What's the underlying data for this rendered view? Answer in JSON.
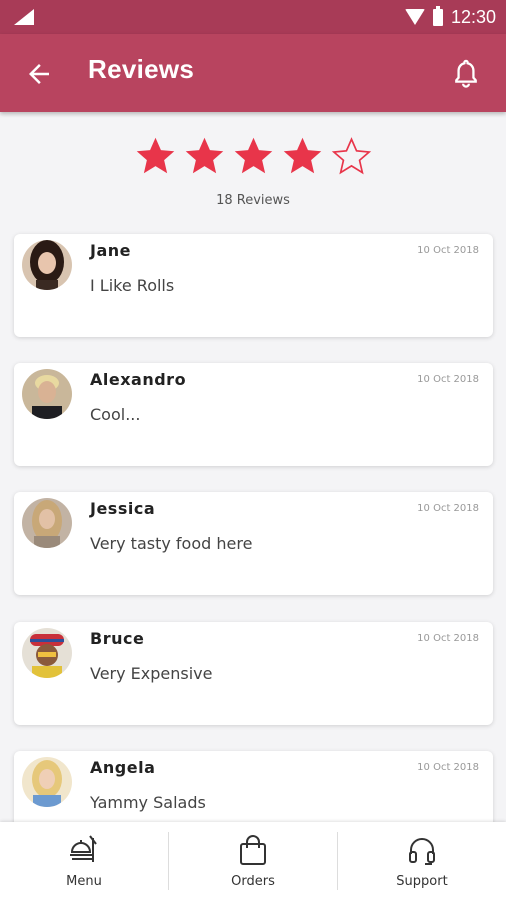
{
  "status": {
    "time": "12:30"
  },
  "header": {
    "title": "Reviews"
  },
  "rating": {
    "value": 4,
    "max": 5,
    "count_label": "18 Reviews"
  },
  "reviews": [
    {
      "name": "Jane",
      "date": "10 Oct 2018",
      "comment": "I Like Rolls"
    },
    {
      "name": "Alexandro",
      "date": "10 Oct 2018",
      "comment": "Cool..."
    },
    {
      "name": "Jessica",
      "date": "10 Oct 2018",
      "comment": "Very tasty food here"
    },
    {
      "name": "Bruce",
      "date": "10 Oct 2018",
      "comment": "Very Expensive"
    },
    {
      "name": "Angela",
      "date": "10 Oct 2018",
      "comment": "Yammy Salads"
    }
  ],
  "nav": {
    "menu": "Menu",
    "orders": "Orders",
    "support": "Support"
  },
  "colors": {
    "primary": "#b8445f",
    "status_bar": "#a83b57",
    "star": "#e8354a"
  }
}
